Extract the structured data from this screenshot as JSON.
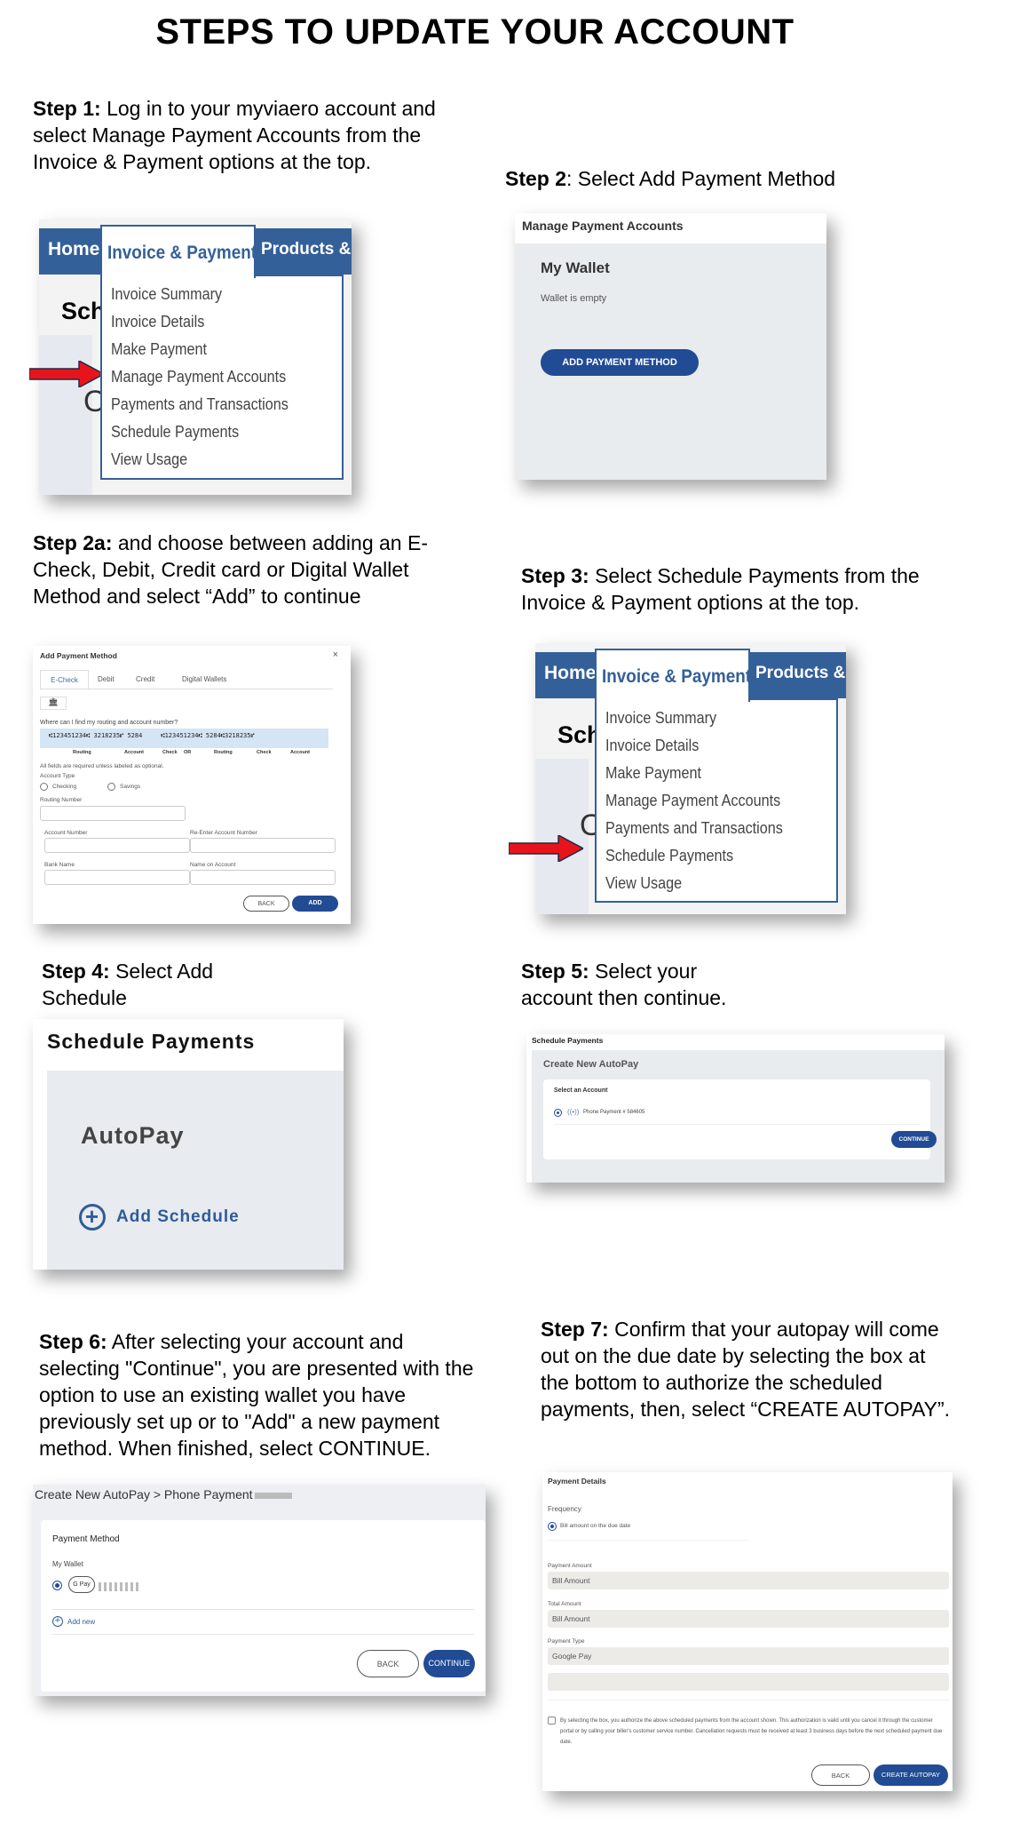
{
  "title": "STEPS TO UPDATE YOUR ACCOUNT",
  "steps": [
    {
      "label": "Step 1:",
      "text": " Log in to your myviaero account and select Manage Payment Accounts from the Invoice & Payment options at the top."
    },
    {
      "label": "Step 2",
      "text": ": Select Add Payment Method"
    },
    {
      "label": "Step 2a:",
      "text": " and choose between adding an E-Check, Debit, Credit card or Digital Wallet Method and select “Add” to continue"
    },
    {
      "label": "Step 3:",
      "text": " Select Schedule Payments from the Invoice & Payment options at the top."
    },
    {
      "label": "Step 4:",
      "text": " Select Add Schedule"
    },
    {
      "label": "Step 5:",
      "text": " Select your account then continue."
    },
    {
      "label": "Step 6:",
      "text": " After selecting your account and selecting \"Continue\", you are presented with the option to use an existing wallet you have previously set up or to \"Add\" a new payment method. When finished, select CONTINUE."
    },
    {
      "label": "Step 7:",
      "text": " Confirm that your autopay will come out on the due date by selecting the box at the bottom to authorize the scheduled payments, then, select “CREATE AUTOPAY”."
    }
  ],
  "nav": {
    "home": "Home",
    "invoice": "Invoice & Payment",
    "products": "Products &",
    "sch": "Sch",
    "o": "O",
    "items": [
      "Invoice Summary",
      "Invoice Details",
      "Make Payment",
      "Manage Payment Accounts",
      "Payments and Transactions",
      "Schedule Payments",
      "View Usage"
    ]
  },
  "step1_highlight": "Manage Payment Accounts",
  "step3_highlight": "Schedule Payments",
  "arrow_color": "#e8141b",
  "brand_color": "#34609a",
  "button_color": "#214b94",
  "manage": {
    "header": "Manage Payment Accounts",
    "wallet_title": "My Wallet",
    "wallet_empty": "Wallet is empty",
    "add_button": "ADD PAYMENT METHOD"
  },
  "add_method": {
    "title": "Add Payment Method",
    "close": "×",
    "tabs": [
      "E-Check",
      "Debit",
      "Credit",
      "Digital Wallets"
    ],
    "active_tab": "E-Check",
    "help": "Where can I find my routing and account number?",
    "check_line": "⑆123451234⑆ 3218235⑈ 5284     ⑆123451234⑆ 5284⑆3218235⑈",
    "check_labels": [
      "Routing",
      "Account",
      "Check",
      "OR",
      "Routing",
      "Check",
      "Account"
    ],
    "required": "All fields are required unless labeled as optional.",
    "account_type": "Account Type",
    "types": [
      "Checking",
      "Savings"
    ],
    "routing": "Routing Number",
    "account_number": "Account Number",
    "reenter": "Re-Enter Account Number",
    "bank": "Bank Name",
    "name": "Name on Account",
    "back": "BACK",
    "add": "ADD"
  },
  "schedule": {
    "header": "Schedule Payments",
    "autopay": "AutoPay",
    "add_schedule": "Add Schedule"
  },
  "select_account": {
    "header": "Schedule Payments",
    "title": "Create New AutoPay",
    "section": "Select an Account",
    "account": "Phone Payment # 584605",
    "continue": "CONTINUE"
  },
  "payment_method": {
    "breadcrumb": "Create New AutoPay > Phone Payment",
    "section": "Payment Method",
    "wallet": "My Wallet",
    "gpay": "G Pay",
    "add_new": "Add new",
    "back": "BACK",
    "continue": "CONTINUE"
  },
  "payment_details": {
    "title": "Payment Details",
    "frequency": "Frequency",
    "option": "Bill amount on the due date",
    "payment_amount_label": "Payment Amount",
    "payment_amount": "Bill Amount",
    "total_label": "Total Amount",
    "total": "Bill Amount",
    "type_label": "Payment Type",
    "type": "Google Pay",
    "consent": "By selecting the box, you authorize the above scheduled payments from the account shown. This authorization is valid until you cancel it through the customer portal or by calling your biller's customer service number. Cancellation requests must be received at least 3 business days before the next scheduled payment due date.",
    "back": "BACK",
    "create": "CREATE AUTOPAY"
  }
}
